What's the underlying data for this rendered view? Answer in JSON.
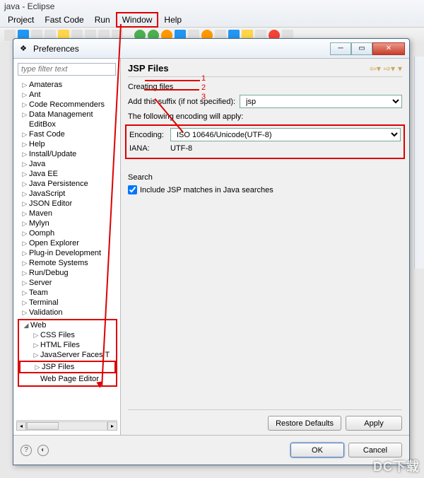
{
  "eclipse": {
    "title": "java - Eclipse",
    "menu": {
      "project": "Project",
      "fastcode": "Fast Code",
      "run": "Run",
      "window": "Window",
      "help": "Help"
    }
  },
  "modal": {
    "title": "Preferences"
  },
  "filter": {
    "placeholder": "type filter text"
  },
  "tree": {
    "items": [
      "Amateras",
      "Ant",
      "Code Recommenders",
      "Data Management",
      "EditBox",
      "Fast Code",
      "Help",
      "Install/Update",
      "Java",
      "Java EE",
      "Java Persistence",
      "JavaScript",
      "JSON Editor",
      "Maven",
      "Mylyn",
      "Oomph",
      "Open Explorer",
      "Plug-in Development",
      "Remote Systems",
      "Run/Debug",
      "Server",
      "Team",
      "Terminal",
      "Validation"
    ],
    "web": {
      "label": "Web",
      "children": [
        "CSS Files",
        "HTML Files",
        "JavaServer Faces T"
      ],
      "jsp": "JSP Files",
      "editor": "Web Page Editor"
    }
  },
  "right": {
    "heading": "JSP Files",
    "creating": "Creating files",
    "suffix_label": "Add this suffix (if not specified):",
    "suffix_value": "jsp",
    "enc_intro": "The following encoding will apply:",
    "enc_label": "Encoding:",
    "enc_value": "ISO 10646/Unicode(UTF-8)",
    "iana_label": "IANA:",
    "iana_value": "UTF-8",
    "search_label": "Search",
    "search_check": "Include JSP matches in Java searches",
    "restore": "Restore Defaults",
    "apply": "Apply",
    "ok": "OK",
    "cancel": "Cancel"
  },
  "ann": {
    "n1": "1",
    "n2": "2",
    "n3": "3"
  }
}
